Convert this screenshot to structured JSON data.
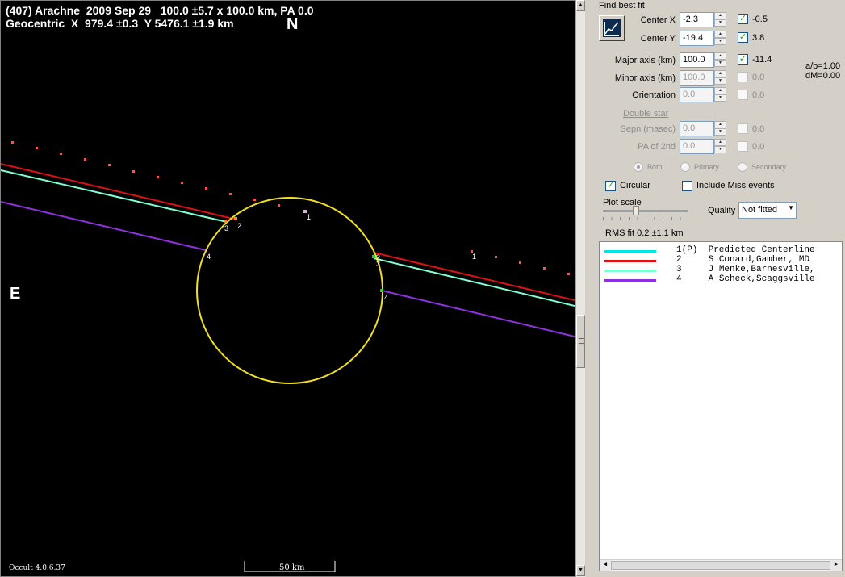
{
  "plot": {
    "title_line1": "(407) Arachne  2009 Sep 29   100.0 ±5.7 x 100.0 km, PA 0.0",
    "title_line2": "Geocentric  X  979.4 ±0.3  Y 5476.1 ±1.9 km",
    "north_label": "N",
    "east_label": "E",
    "version": "Occult 4.0.6.37",
    "scale_label": "50 km",
    "chord_labels": [
      "1",
      "2",
      "3",
      "4"
    ],
    "colors": {
      "ellipse": "#f0e020",
      "predicted": "#00e5e5",
      "chord2": "#e01010",
      "chord3": "#7fffd4",
      "chord4": "#9030e0",
      "dots": "#ff5050"
    }
  },
  "panel": {
    "find_best_fit": "Find best fit",
    "fit_button_icon": "fit-chart-icon",
    "center_x": {
      "label": "Center X",
      "value": "-2.3",
      "checked": true,
      "delta": "-0.5"
    },
    "center_y": {
      "label": "Center Y",
      "value": "-19.4",
      "checked": true,
      "delta": "3.8"
    },
    "major_axis": {
      "label": "Major axis (km)",
      "value": "100.0",
      "checked": true,
      "delta": "-11.4"
    },
    "minor_axis": {
      "label": "Minor axis (km)",
      "value": "100.0",
      "checked": false,
      "delta": "0.0"
    },
    "orientation": {
      "label": "Orientation",
      "value": "0.0",
      "checked": false,
      "delta": "0.0"
    },
    "ab_ratio": "a/b=1.00",
    "dm": "dM=0.00",
    "double_star": "Double star",
    "sepn": {
      "label": "Sepn (masec)",
      "value": "0.0",
      "checked": false,
      "delta": "0.0"
    },
    "pa2": {
      "label": "PA of 2nd",
      "value": "0.0",
      "checked": false,
      "delta": "0.0"
    },
    "radio_both": "Both",
    "radio_primary": "Primary",
    "radio_secondary": "Secondary",
    "circular": {
      "label": "Circular",
      "checked": true
    },
    "include_miss": {
      "label": "Include Miss events",
      "checked": false
    },
    "plot_scale": "Plot scale",
    "quality_label": "Quality",
    "quality_value": "Not fitted",
    "rms_fit": "RMS fit  0.2 ±1.1 km",
    "legend": [
      {
        "id": "1(P)",
        "text": "Predicted Centerline",
        "color": "#00e5e5"
      },
      {
        "id": "2",
        "text": "S Conard,Gamber, MD",
        "color": "#e01010"
      },
      {
        "id": "3",
        "text": "J Menke,Barnesville,",
        "color": "#7fffd4"
      },
      {
        "id": "4",
        "text": "A Scheck,Scaggsville",
        "color": "#9030e0"
      }
    ]
  }
}
